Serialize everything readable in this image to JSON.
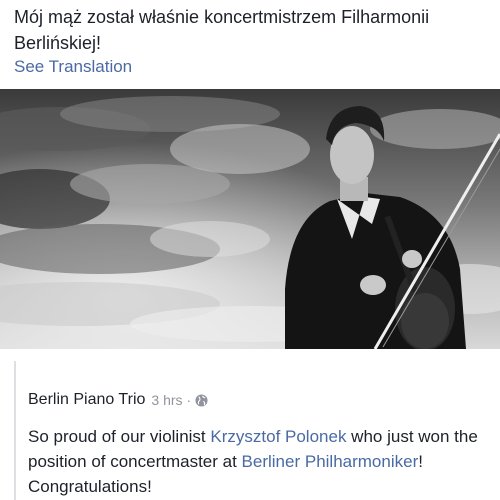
{
  "post": {
    "text_line1": "Mój mąż został właśnie koncertmistrzem Filharmonii",
    "text_line2": "Berlińskiej!",
    "see_translation": "See Translation"
  },
  "shared_post": {
    "page_name": "Berlin Piano Trio",
    "time": "3 hrs",
    "separator": "·",
    "privacy_icon": "globe-icon",
    "body_part1": "So proud of our violinist ",
    "mention1": "Krzysztof Polonek",
    "body_part2": " who just won the position of concertmaster at ",
    "mention2": "Berliner Philharmoniker",
    "body_part3": "! Congratulations!"
  },
  "colors": {
    "link": "#4a6aa5",
    "secondary_text": "#90949c",
    "text": "#1d2129"
  }
}
